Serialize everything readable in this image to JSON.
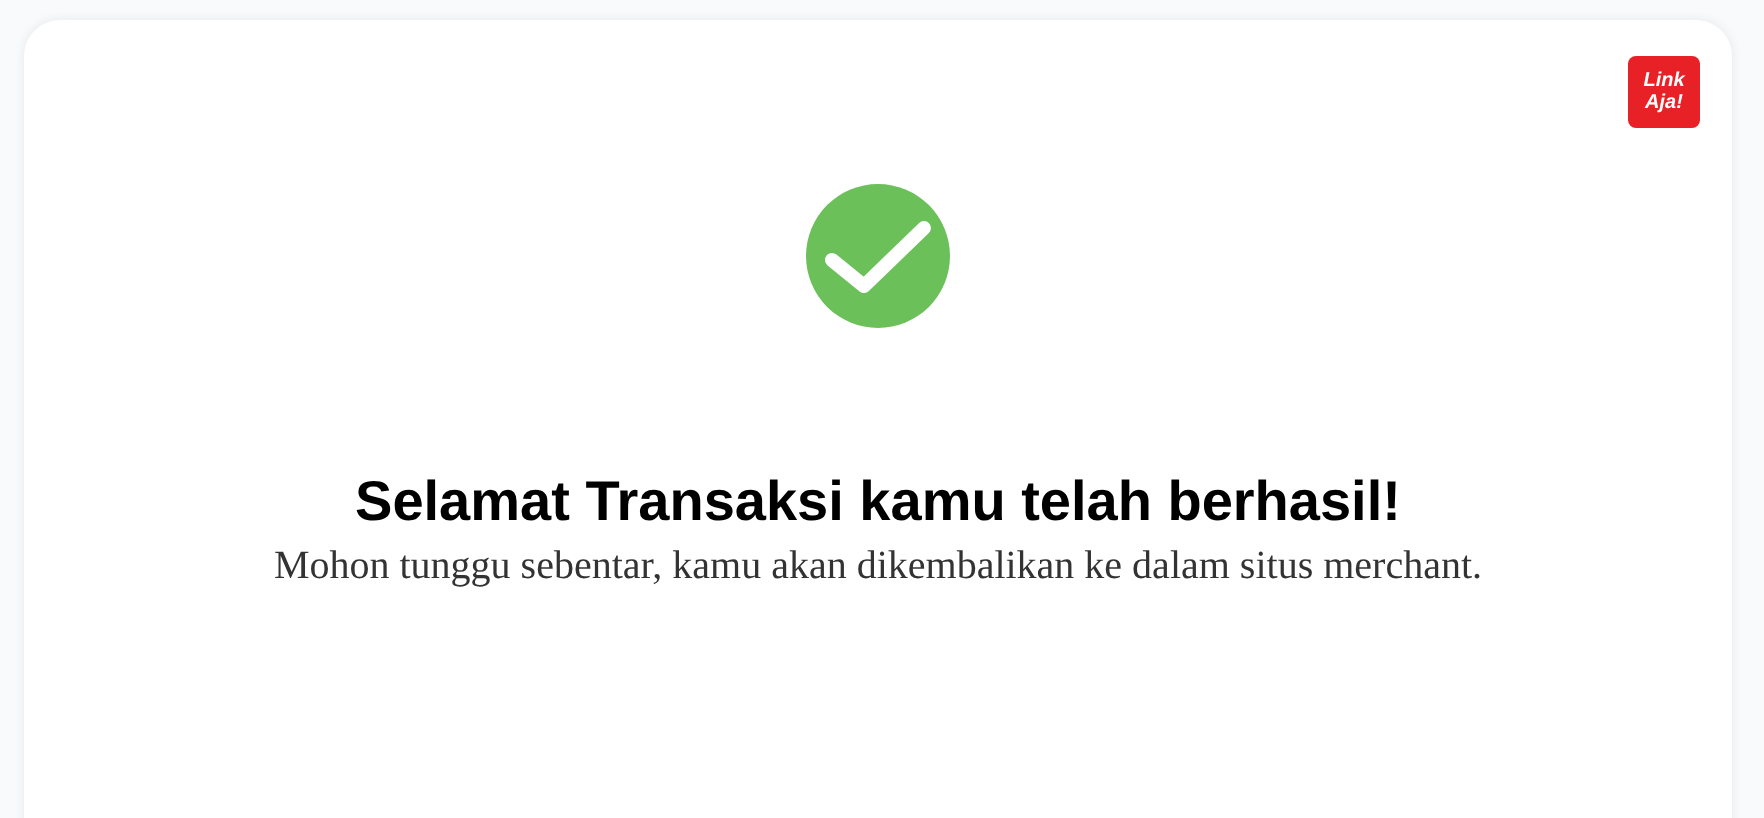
{
  "logo": {
    "lines": [
      "Link",
      "Aja!"
    ]
  },
  "status": {
    "kind": "success"
  },
  "title": "Selamat Transaksi kamu telah berhasil!",
  "message": "Mohon tunggu sebentar, kamu akan dikembalikan ke dalam situs merchant."
}
